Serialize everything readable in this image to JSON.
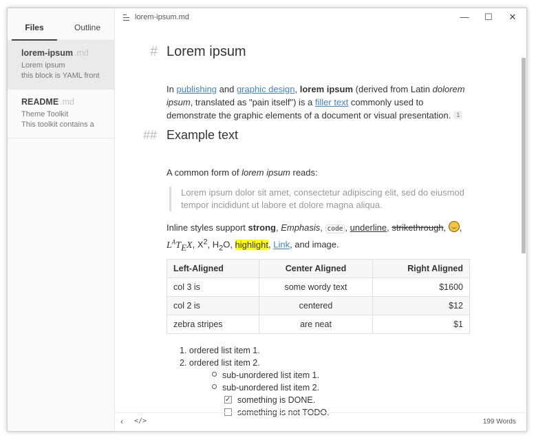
{
  "sidebar": {
    "tabs": [
      {
        "label": "Files"
      },
      {
        "label": "Outline"
      }
    ],
    "files": [
      {
        "title": "lorem-ipsum",
        "ext": ".md",
        "line1": "Lorem ipsum",
        "line2": "this block is YAML front"
      },
      {
        "title": "README",
        "ext": ".md",
        "line1": "Theme Toolkit",
        "line2": "This toolkit contains a"
      }
    ]
  },
  "titlebar": {
    "doc_title": "lorem-ipsum.md",
    "minimize": "—",
    "maximize": "☐",
    "close": "✕"
  },
  "doc": {
    "h1": {
      "mark": "#",
      "text": "Lorem ipsum"
    },
    "p1": {
      "t1": "In ",
      "link1": "publishing",
      "t2": " and ",
      "link2": "graphic design",
      "t3": ", ",
      "bold": "lorem ipsum",
      "t4": " (derived from Latin ",
      "ital1": "dolorem ipsum",
      "t5": ", translated as \"pain itself\") is a ",
      "link3": "filler text",
      "t6": " commonly used to demonstrate the graphic elements of a document or visual presentation.",
      "fn": "1"
    },
    "h2": {
      "mark": "##",
      "text": "Example text"
    },
    "p2": {
      "t1": "A common form of ",
      "ital": "lorem ipsum",
      "t2": " reads:"
    },
    "quote": "Lorem ipsum dolor sit amet, consectetur adipiscing elit, sed do eiusmod tempor incididunt ut labore et dolore magna aliqua.",
    "p3": {
      "t1": "Inline styles support ",
      "strong": "strong",
      "c1": ", ",
      "emph": "Emphasis",
      "c2": ", ",
      "code": "code",
      "c3": ", ",
      "underline": "underline",
      "c4": ", ",
      "strike": "strikethrough",
      "c5": ", ",
      "c6": ",",
      "latex": "LATEX",
      "c7": ", X",
      "sup": "2",
      "c8": ", H",
      "sub": "2",
      "c9": "O, ",
      "highlight": "highlight",
      "c10": ", ",
      "link": "Link",
      "c11": ", and image."
    },
    "table": {
      "headers": [
        "Left-Aligned",
        "Center Aligned",
        "Right Aligned"
      ],
      "rows": [
        [
          "col 3 is",
          "some wordy text",
          "$1600"
        ],
        [
          "col 2 is",
          "centered",
          "$12"
        ],
        [
          "zebra stripes",
          "are neat",
          "$1"
        ]
      ]
    },
    "list": {
      "ol": [
        "1. ordered list item 1.",
        "2. ordered list item 2."
      ],
      "ul": [
        "sub-unordered list item 1.",
        "sub-unordered list item 2."
      ],
      "tasks": [
        {
          "label": "something is DONE.",
          "checked": true
        },
        {
          "label": "something is not TODO.",
          "checked": false
        }
      ]
    }
  },
  "footer": {
    "back": "‹",
    "source": "</>",
    "words": "199 Words"
  },
  "colors": {
    "link": "#4183c4",
    "highlight": "#ffff00"
  }
}
